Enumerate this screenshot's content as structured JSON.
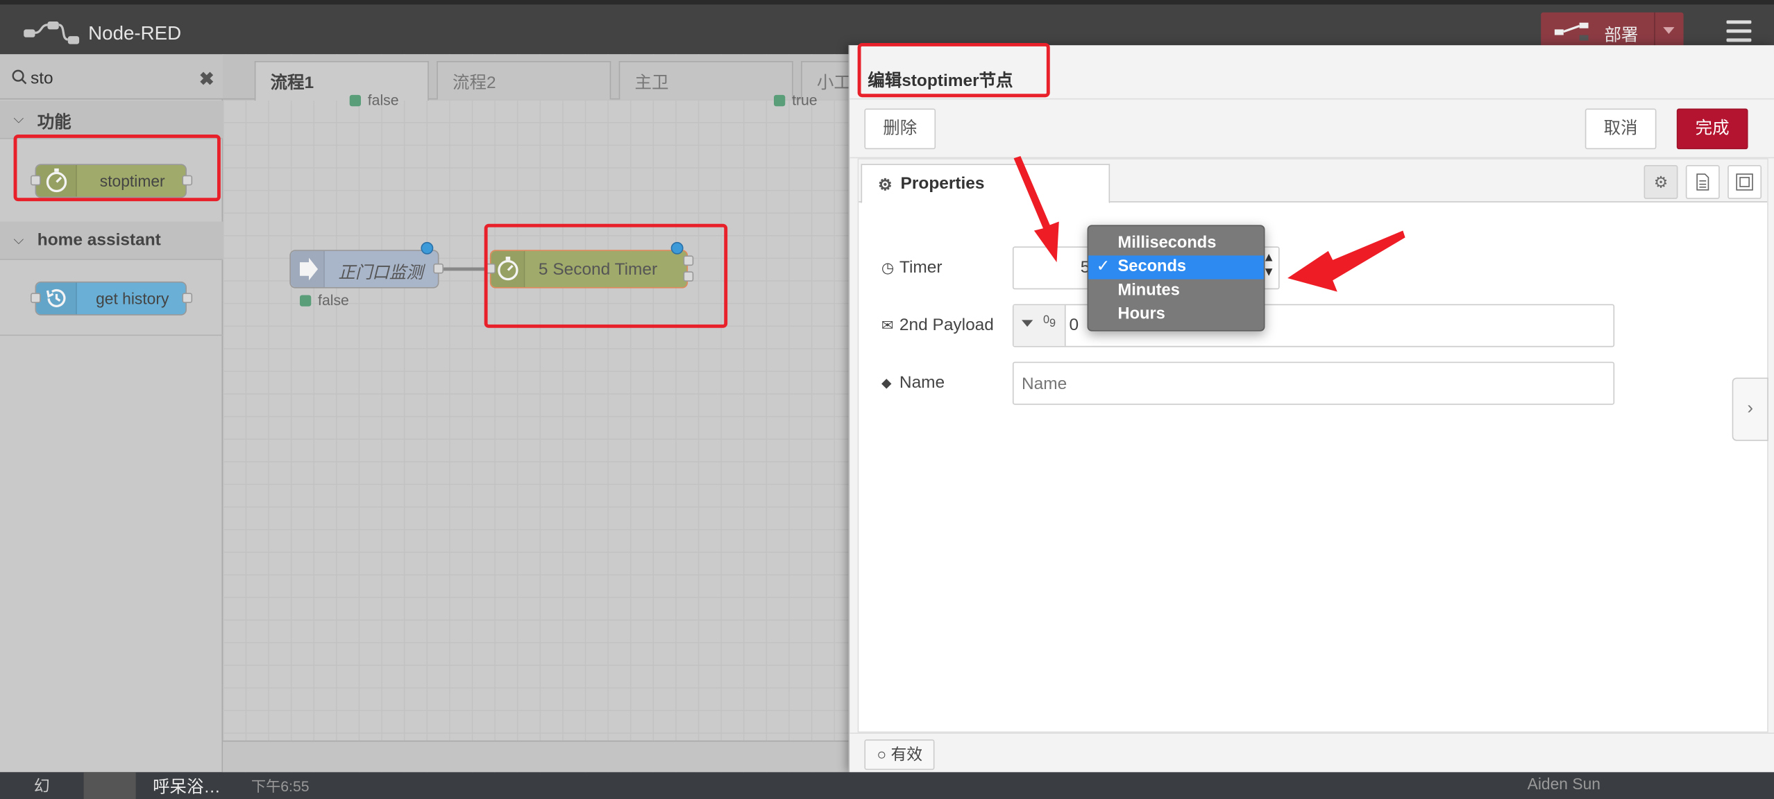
{
  "app": {
    "title": "Node-RED",
    "deploy_label": "部署"
  },
  "palette": {
    "search_value": "sto",
    "categories": [
      {
        "name": "功能",
        "nodes": [
          {
            "label": "stoptimer"
          }
        ]
      },
      {
        "name": "home assistant",
        "nodes": [
          {
            "label": "get history"
          }
        ]
      }
    ]
  },
  "workspace": {
    "tabs": [
      {
        "label": "流程1"
      },
      {
        "label": "流程2"
      },
      {
        "label": "主卫"
      },
      {
        "label": "小工"
      }
    ],
    "nodes": [
      {
        "label": "正门口监测"
      },
      {
        "label": "5 Second Timer"
      }
    ],
    "statuses": [
      {
        "text": "false"
      },
      {
        "text": "true"
      },
      {
        "text": "false"
      }
    ]
  },
  "editor": {
    "title": "编辑stoptimer节点",
    "delete_label": "删除",
    "cancel_label": "取消",
    "done_label": "完成",
    "properties_tab": "Properties",
    "fields": {
      "timer": {
        "label": "Timer",
        "value": "5"
      },
      "payload": {
        "label": "2nd Payload",
        "type_glyph": "0",
        "type_glyph_sub": "9",
        "value": "0"
      },
      "name": {
        "label": "Name",
        "placeholder": "Name",
        "value": ""
      }
    },
    "enabled_label": "有效"
  },
  "dropdown": {
    "options": [
      "Milliseconds",
      "Seconds",
      "Minutes",
      "Hours"
    ],
    "selected": "Seconds",
    "check_mark": "✓"
  },
  "bottom_strip": {
    "items": [
      "幻",
      "呼呆浴…",
      "下午6:55",
      "Aiden Sun"
    ]
  },
  "colors": {
    "accent": "#b4142f",
    "highlight": "#e8202a",
    "selected_option": "#2d8af0"
  }
}
